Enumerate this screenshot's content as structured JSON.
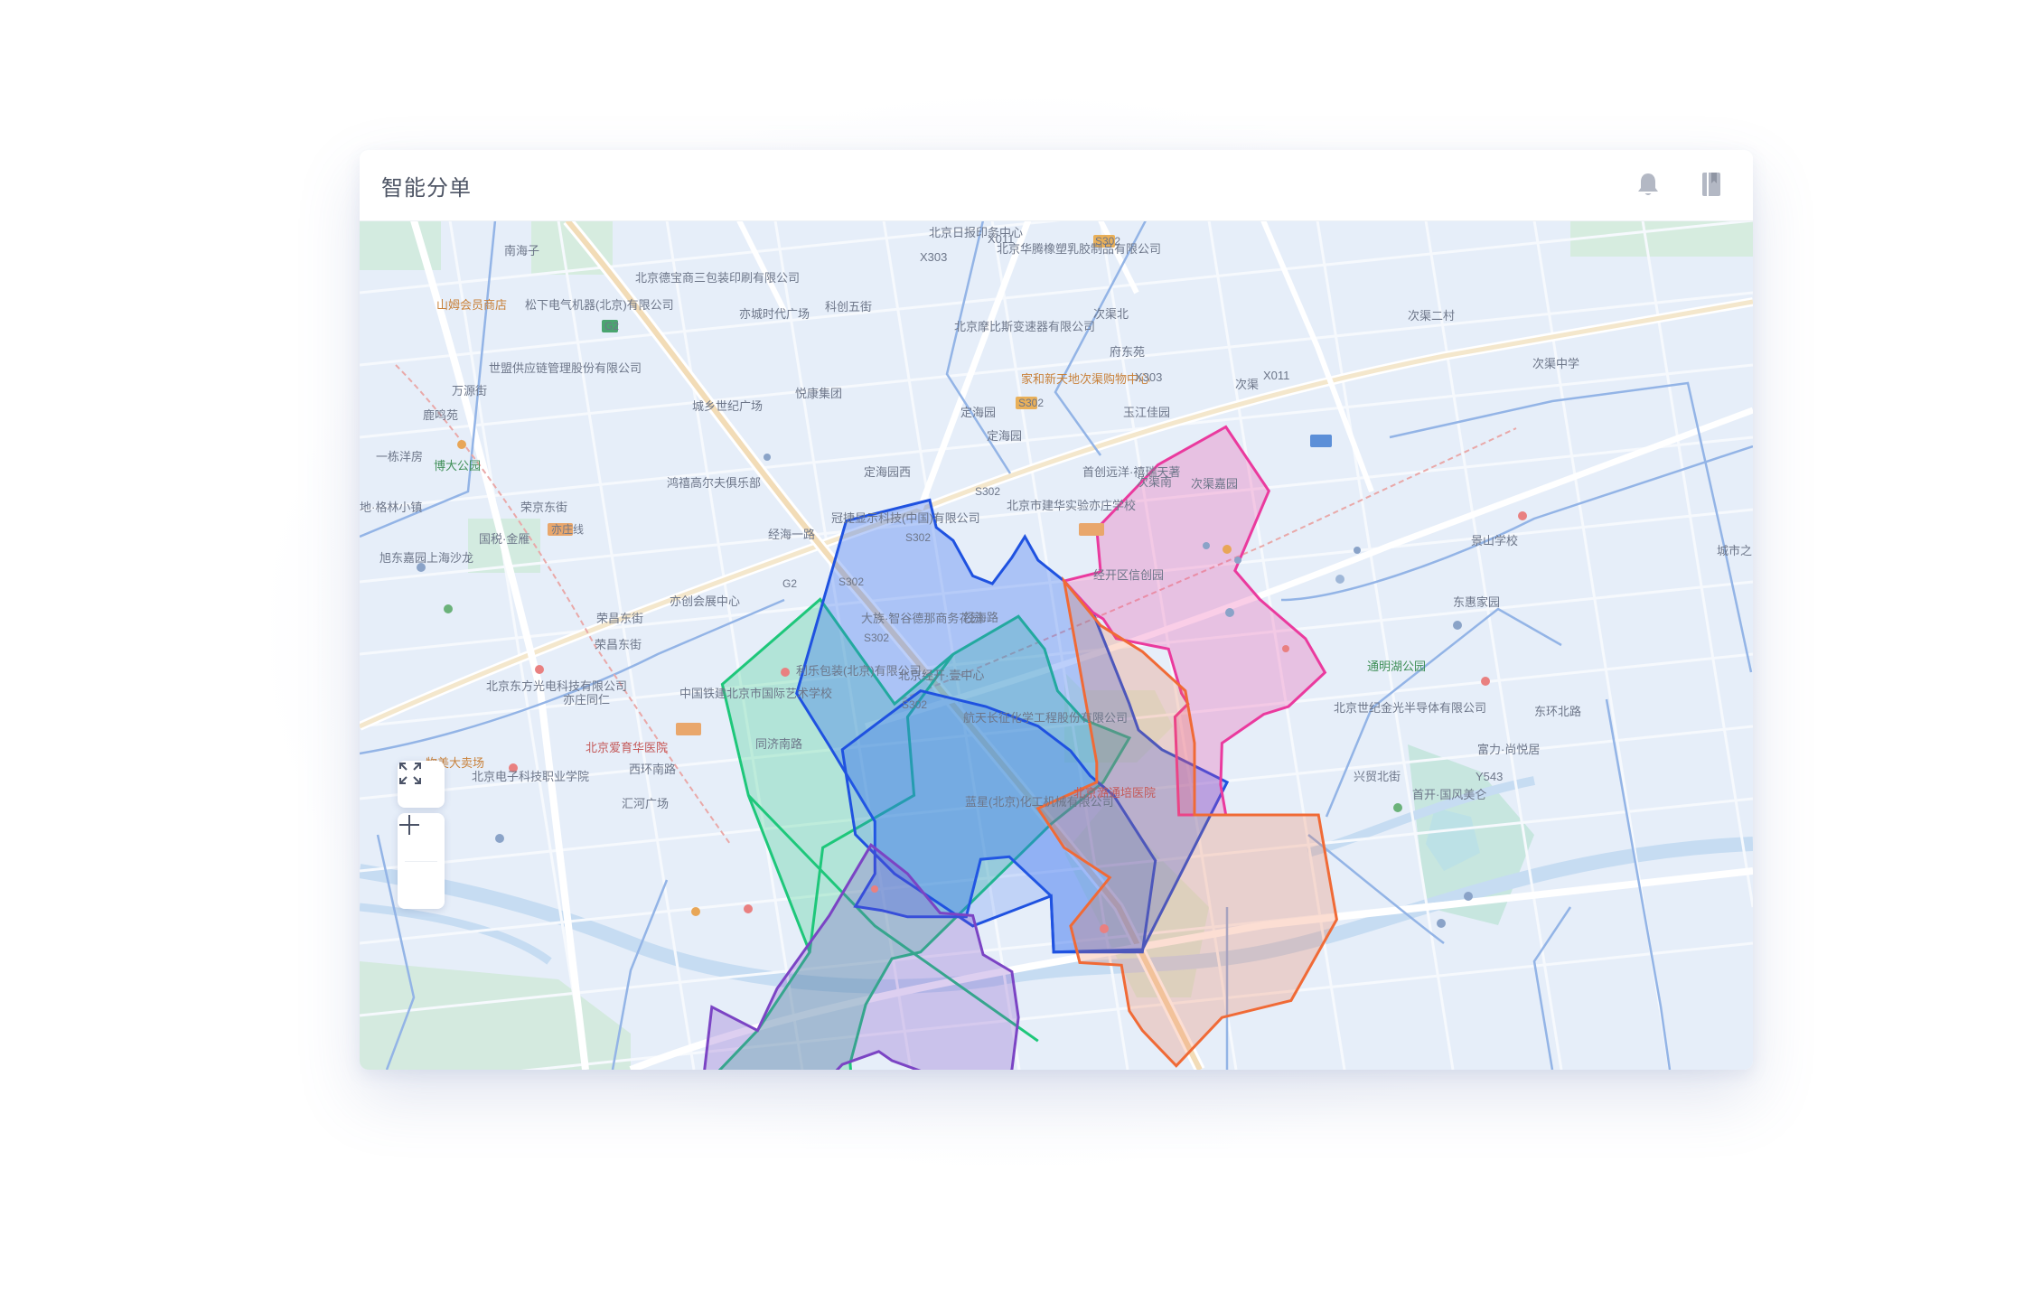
{
  "app": {
    "title": "智能分单"
  },
  "header": {
    "bell_icon": "bell-icon",
    "book_icon": "book-icon"
  },
  "colors": {
    "green_zone": "#1ec77a",
    "blue_zone": "#1f52e0",
    "purple_zone": "#7b44c4",
    "magenta_zone": "#ea3a9e",
    "orange_zone": "#f06a36",
    "map_bg": "#e6eef9"
  },
  "map": {
    "labels": [
      "北京日报印务中心",
      "X011",
      "北京华腾橡塑乳胶制品有限公司",
      "X303",
      "S302",
      "北京德宝商三包装印刷有限公司",
      "亦城时代广场",
      "科创五街",
      "松下电气机器(北京)有限公司",
      "山姆会员商店",
      "G2",
      "北京摩比斯变速器有限公司",
      "次渠北",
      "府东苑",
      "次渠中学",
      "世盟供应链管理股份有限公司",
      "万源街",
      "城乡世纪广场",
      "悦康集团",
      "家和新天地次渠购物中心",
      "X303",
      "X011",
      "次渠",
      "鹿鸣苑",
      "S302",
      "定海园",
      "玉江佳园",
      "定海园",
      "一栋洋房",
      "博大公园",
      "鸿禧高尔夫俱乐部",
      "定海园西",
      "首创远洋·禧瑞天著",
      "次渠南",
      "次渠嘉园",
      "荣京东街",
      "S302",
      "北京市建华实验亦庄学校",
      "地·格林小镇",
      "冠捷显示科技(中国)有限公司",
      "国税·金雁",
      "经海一路",
      "S302",
      "亦庄线",
      "景山学校",
      "城市之",
      "旭东嘉园上海沙龙",
      "经开区信创园",
      "G2",
      "S302",
      "亦创会展中心",
      "东惠家园",
      "荣昌东街",
      "荣昌东街",
      "大族·智谷德那商务花园",
      "经海路",
      "S302",
      "通明湖公园",
      "北京东方光电科技有限公司",
      "利乐包装(北京)有限公司",
      "北京经开·壹中心",
      "亦庄同仁",
      "中国铁建北京市国际艺术学校",
      "北京世纪金光半导体有限公司",
      "S302",
      "航天长征化学工程股份有限公司",
      "北京爱育华医院",
      "同济南路",
      "富力·尚悦居",
      "物美大卖场",
      "北京电子科技职业学院",
      "西环南路",
      "Y543",
      "兴贸北街",
      "首开·国风美仑",
      "北京潞通培医院",
      "蓝星(北京)化工机械有限公司",
      "汇河广场",
      "东环北路",
      "次渠二村",
      "南海子"
    ]
  },
  "zones": {
    "green": {
      "name": "green-zone"
    },
    "blue": {
      "name": "blue-zone"
    },
    "purple": {
      "name": "purple-zone"
    },
    "magenta": {
      "name": "magenta-zone"
    },
    "orange": {
      "name": "orange-zone"
    }
  },
  "controls": {
    "expand_icon": "expand-icon",
    "zoom_in_icon": "zoom-in-icon",
    "zoom_out_icon": "zoom-out-icon"
  }
}
